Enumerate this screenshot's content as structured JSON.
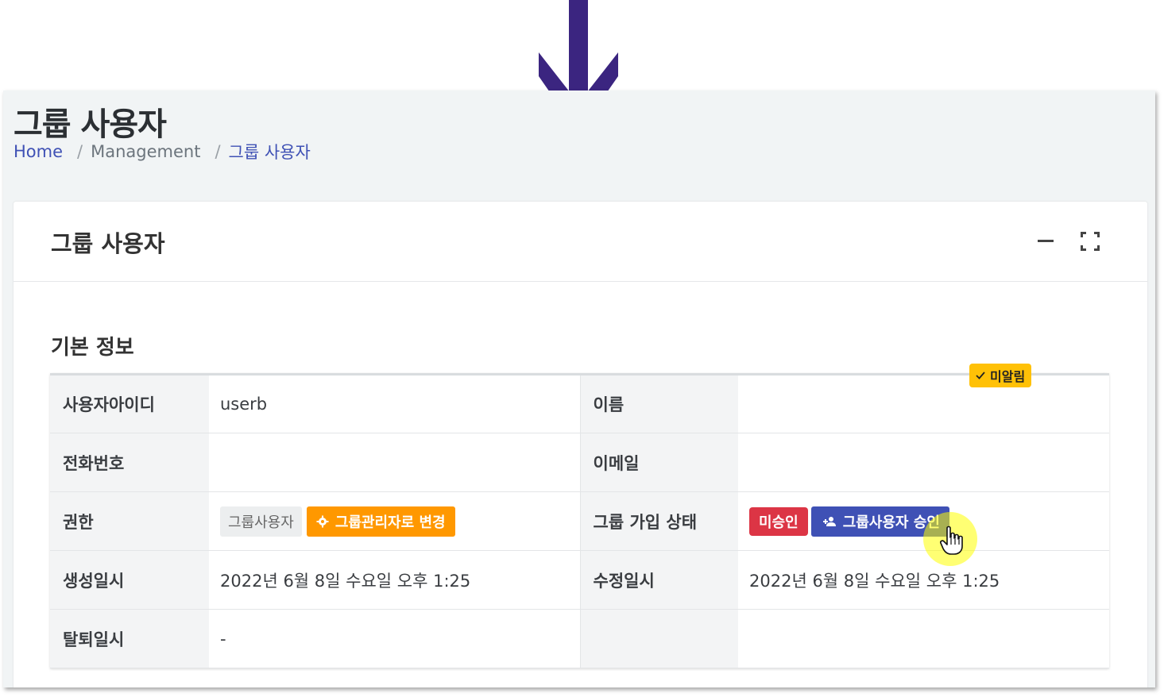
{
  "page": {
    "title": "그룹 사용자",
    "breadcrumb": [
      "Home",
      "Management",
      "그룹 사용자"
    ]
  },
  "card": {
    "title": "그룹 사용자",
    "section_title": "기본 정보"
  },
  "fields": {
    "user_id_label": "사용자아이디",
    "user_id_value": "userb",
    "name_label": "이름",
    "name_value": "",
    "phone_label": "전화번호",
    "phone_value": "",
    "email_label": "이메일",
    "email_value": "",
    "email_badge": "미알림",
    "role_label": "권한",
    "role_value": "그룹사용자",
    "role_change_button": "그룹관리자로 변경",
    "join_status_label": "그룹 가입 상태",
    "join_status_badge": "미승인",
    "approve_button": "그룹사용자 승인",
    "created_label": "생성일시",
    "created_value": "2022년 6월 8일 수요일 오후 1:25",
    "modified_label": "수정일시",
    "modified_value": "2022년 6월 8일 수요일 오후 1:25",
    "withdrawn_label": "탈퇴일시",
    "withdrawn_value": "-"
  },
  "colors": {
    "arrow": "#3b2580",
    "accent": "#3f51b5",
    "orange": "#ff9800",
    "red": "#dc3545",
    "yellow": "#ffc107"
  },
  "icons": [
    "down-arrow-icon",
    "minimize-icon",
    "expand-icon",
    "gear-icon",
    "check-icon",
    "user-add-icon",
    "hand-cursor-icon"
  ]
}
